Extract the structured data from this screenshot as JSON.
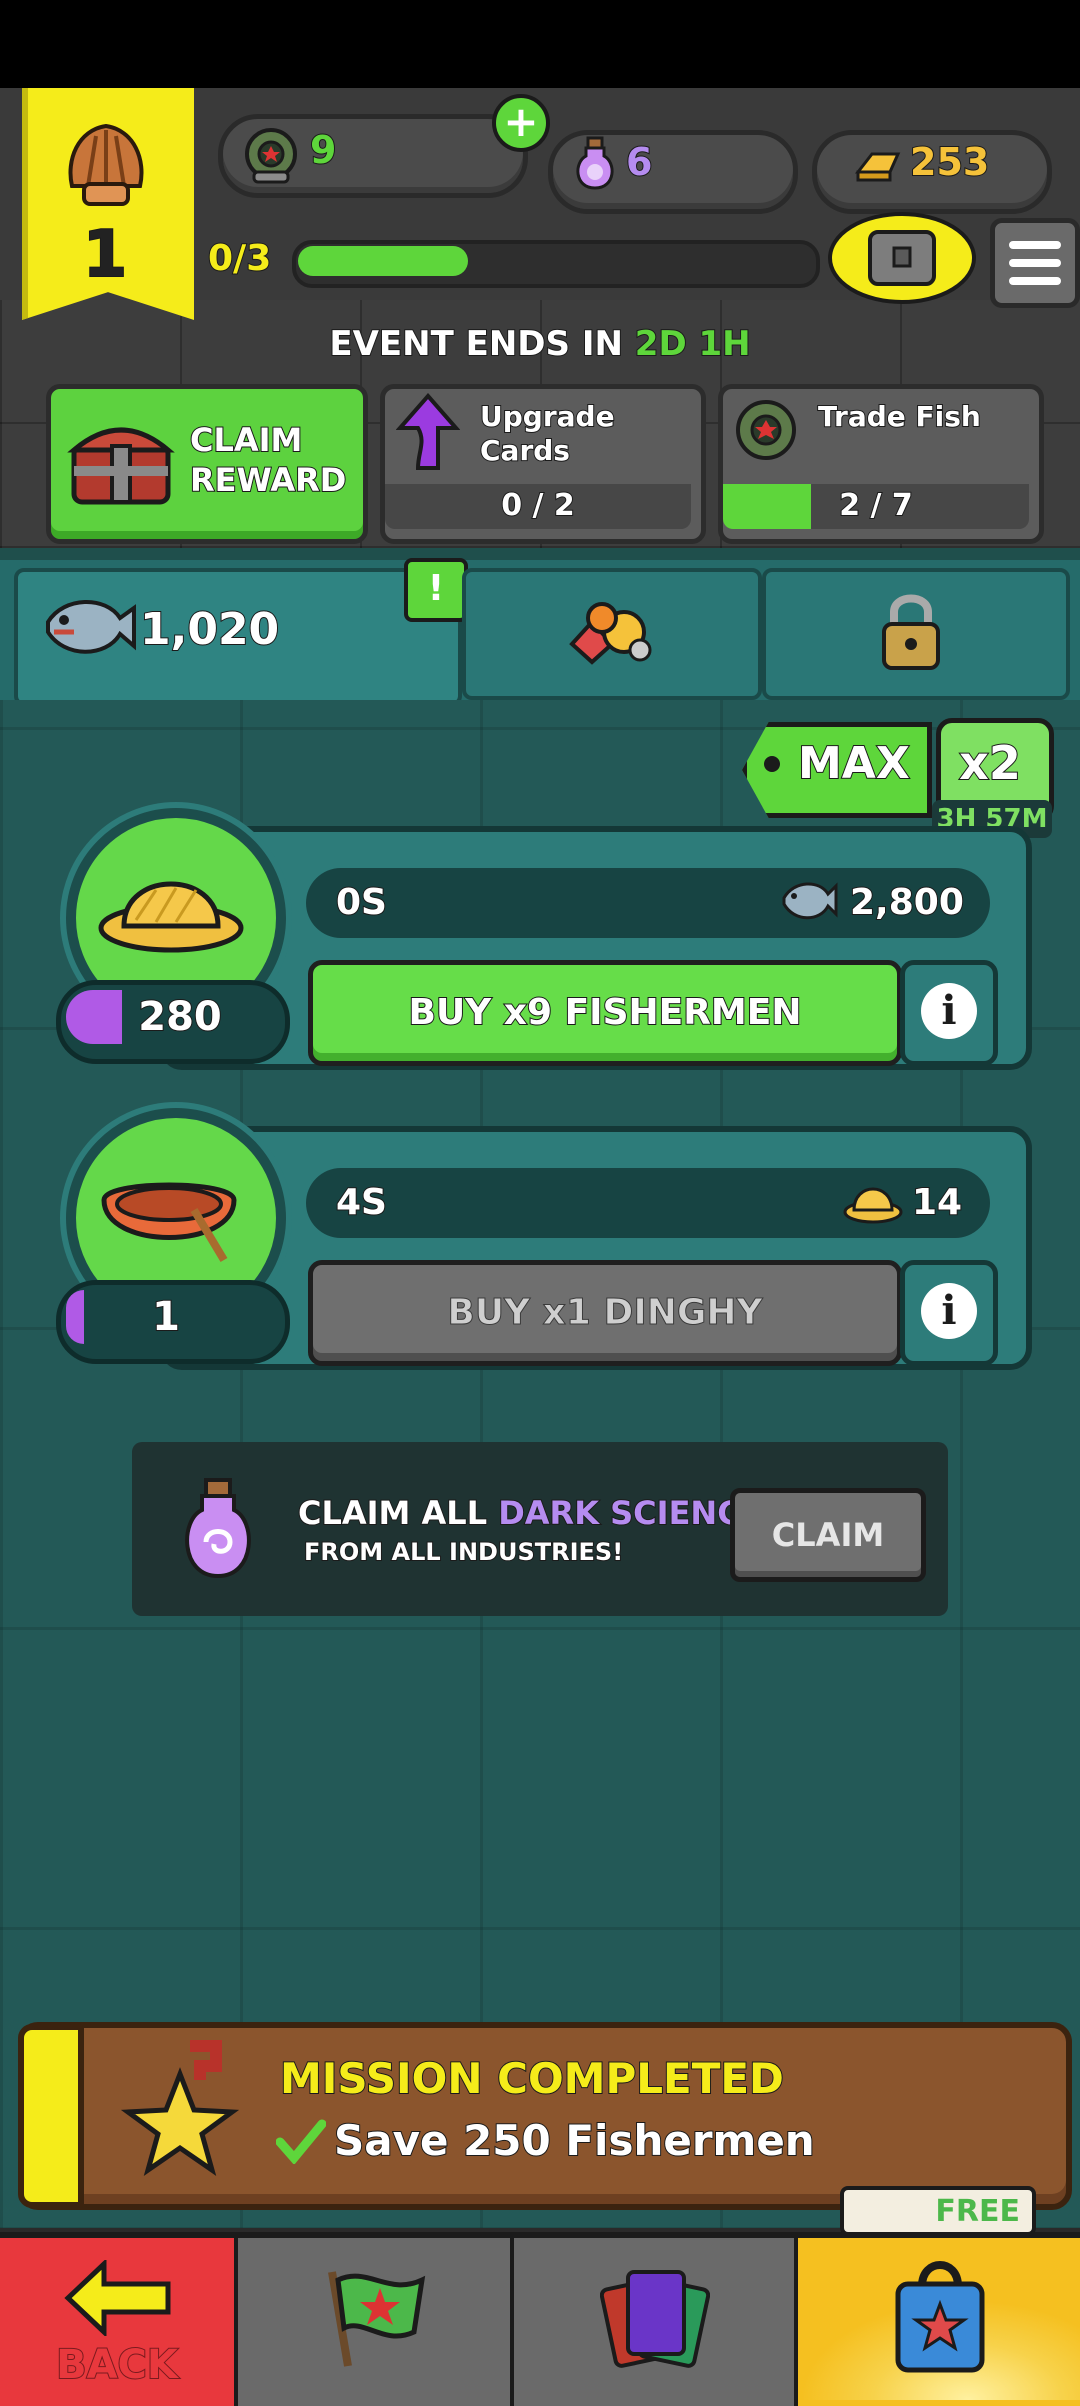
{
  "header": {
    "level": "1",
    "resources": {
      "fish_tokens": "9",
      "dark_science": "6",
      "gold": "253"
    },
    "progress_text": "0/3",
    "progress_fraction": 0.33,
    "menu_icon": "hamburger-menu-icon"
  },
  "event": {
    "ends_label": "EVENT ENDS IN",
    "ends_time": "2D 1H",
    "claim_reward_line1": "CLAIM",
    "claim_reward_line2": "REWARD",
    "upgrade_cards_line1": "Upgrade",
    "upgrade_cards_line2": "Cards",
    "upgrade_progress": "0 / 2",
    "upgrade_fraction": 0.0,
    "trade_fish_label": "Trade Fish",
    "trade_progress": "2 / 7",
    "trade_fraction": 0.2857
  },
  "tabs": {
    "fish_count": "1,020",
    "alert_badge": "!"
  },
  "multiplier": {
    "max_label": "MAX",
    "boost_label": "x2",
    "boost_timer": "3H 57M"
  },
  "industries": [
    {
      "timer": "0S",
      "reward_value": "2,800",
      "count": "280",
      "button_label": "BUY x9 FISHERMEN",
      "fill_fraction": 0.25
    },
    {
      "timer": "4S",
      "reward_value": "14",
      "count": "1",
      "button_label": "BUY x1 DINGHY",
      "fill_fraction": 0.05
    }
  ],
  "dark_science_claim": {
    "line1_prefix": "CLAIM ALL ",
    "line1_highlight": "DARK SCIENCE",
    "line2": "FROM ALL INDUSTRIES!",
    "button_label": "CLAIM"
  },
  "mission": {
    "title": "MISSION COMPLETED",
    "description": "Save 250 Fishermen"
  },
  "nav": {
    "back_label": "BACK",
    "shop_tag": "FREE"
  },
  "colors": {
    "accent_green": "#5ed63b",
    "dark_science_purple": "#b58cf0",
    "gold": "#f5c23a",
    "banner_yellow": "#f5ec1a",
    "back_red": "#e8383d"
  }
}
